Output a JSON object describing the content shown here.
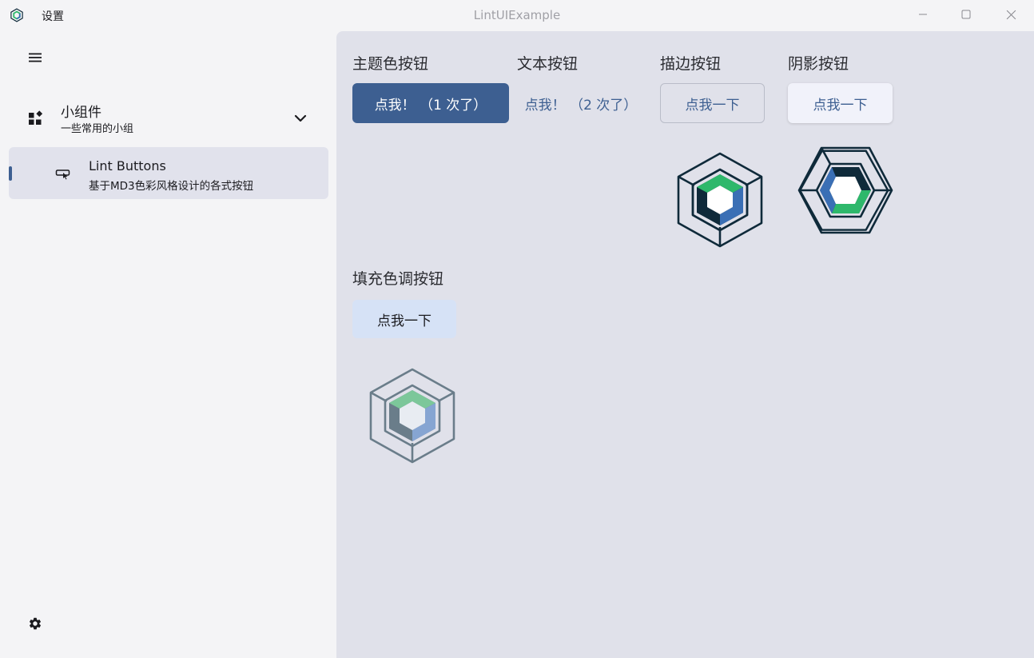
{
  "titlebar": {
    "app_icon": "hexagon-logo-icon",
    "title": "设置",
    "window_title": "LintUIExample",
    "minimize_icon": "minimize-icon",
    "maximize_icon": "maximize-icon",
    "close_icon": "close-icon"
  },
  "sidebar": {
    "menu_icon": "hamburger-menu-icon",
    "group": {
      "icon": "widgets-icon",
      "title": "小组件",
      "subtitle": "一些常用的小组",
      "expand_icon": "chevron-down-icon"
    },
    "items": [
      {
        "icon": "button-cursor-icon",
        "title": "Lint Buttons",
        "subtitle": "基于MD3色彩风格设计的各式按钮",
        "selected": true
      }
    ],
    "settings_icon": "gear-icon"
  },
  "content": {
    "sections": {
      "theme": {
        "label": "主题色按钮",
        "button": "点我！ （1 次了）"
      },
      "text": {
        "label": "文本按钮",
        "button": "点我！ （2 次了）"
      },
      "outline": {
        "label": "描边按钮",
        "button": "点我一下"
      },
      "shadow": {
        "label": "阴影按钮",
        "button": "点我一下"
      },
      "tonal": {
        "label": "填充色调按钮",
        "button": "点我一下"
      }
    }
  },
  "colors": {
    "primary": "#3d5f91",
    "content_bg": "#e0e1ea",
    "sidebar_bg": "#f4f4f6",
    "selected_bg": "#e1e2ec",
    "tonal_bg": "#d6e2f6",
    "logo_dark": "#0f2a3a",
    "logo_green": "#2eb86b",
    "logo_blue": "#3a6fb5"
  }
}
